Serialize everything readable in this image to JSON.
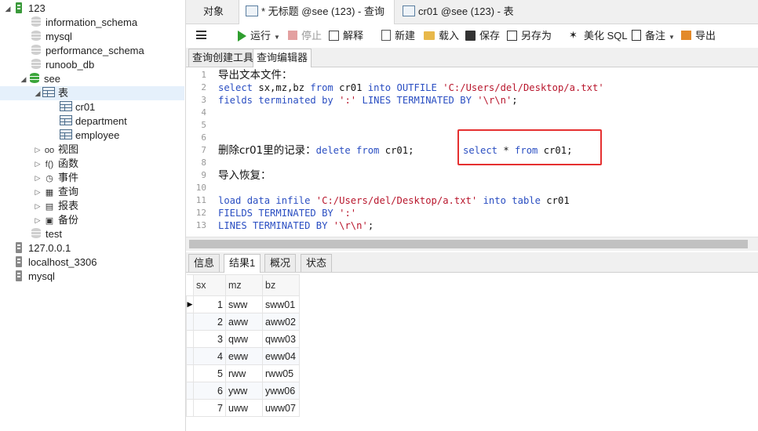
{
  "tree": {
    "connection_name": "123",
    "databases": [
      "information_schema",
      "mysql",
      "performance_schema",
      "runoob_db"
    ],
    "active_db": "see",
    "tables_label": "表",
    "tables": [
      "cr01",
      "department",
      "employee"
    ],
    "groups": [
      {
        "label": "视图",
        "glyph": "oo"
      },
      {
        "label": "函数",
        "glyph": "f()"
      },
      {
        "label": "事件",
        "glyph": "◷"
      },
      {
        "label": "查询",
        "glyph": "▦"
      },
      {
        "label": "报表",
        "glyph": "▤"
      },
      {
        "label": "备份",
        "glyph": "▣"
      }
    ],
    "other_db": "test",
    "other_connections": [
      "127.0.0.1",
      "localhost_3306",
      "mysql"
    ]
  },
  "tabs": {
    "objects": "对象",
    "query_tab": "* 无标题 @see (123) - 查询",
    "table_tab": "cr01 @see (123) - 表"
  },
  "toolbar": {
    "run": "运行",
    "stop": "停止",
    "explain": "解释",
    "new": "新建",
    "load": "载入",
    "save": "保存",
    "save_as": "另存为",
    "beautify": "美化 SQL",
    "comment": "备注",
    "export": "导出"
  },
  "subtabs": {
    "builder": "查询创建工具",
    "editor": "查询编辑器"
  },
  "editor": {
    "lines": [
      {
        "n": "1",
        "text": "导出文本文件：",
        "type": "cn"
      },
      {
        "n": "2",
        "text": "select sx,mz,bz from cr01 into OUTFILE 'C:/Users/del/Desktop/a.txt'",
        "type": "code"
      },
      {
        "n": "3",
        "text": "fields terminated by ':' LINES TERMINATED BY '\\r\\n';",
        "type": "code"
      },
      {
        "n": "4",
        "text": "",
        "type": "code"
      },
      {
        "n": "5",
        "text": "",
        "type": "code"
      },
      {
        "n": "6",
        "text": "",
        "type": "code"
      },
      {
        "n": "7",
        "text": "删除cr01里的记录：delete from cr01;",
        "type": "mixed",
        "extra": "select * from cr01;"
      },
      {
        "n": "8",
        "text": "",
        "type": "code"
      },
      {
        "n": "9",
        "text": "导入恢复：",
        "type": "cn"
      },
      {
        "n": "10",
        "text": "",
        "type": "code"
      },
      {
        "n": "11",
        "text": "load data infile 'C:/Users/del/Desktop/a.txt' into table cr01",
        "type": "code"
      },
      {
        "n": "12",
        "text": "FIELDS TERMINATED BY ':'",
        "type": "code"
      },
      {
        "n": "13",
        "text": "LINES TERMINATED BY '\\r\\n';",
        "type": "code"
      }
    ],
    "colors": {
      "keyword": "#2a4ec2",
      "string": "#b8162c",
      "plain": "#111111",
      "highlight": "#e53030"
    }
  },
  "result_tabs": [
    "信息",
    "结果1",
    "概况",
    "状态"
  ],
  "result_active": "结果1",
  "grid": {
    "columns": [
      "sx",
      "mz",
      "bz"
    ],
    "rows": [
      [
        "1",
        "sww",
        "sww01"
      ],
      [
        "2",
        "aww",
        "aww02"
      ],
      [
        "3",
        "qww",
        "qww03"
      ],
      [
        "4",
        "eww",
        "eww04"
      ],
      [
        "5",
        "rww",
        "rww05"
      ],
      [
        "6",
        "yww",
        "yww06"
      ],
      [
        "7",
        "uww",
        "uww07"
      ]
    ]
  }
}
